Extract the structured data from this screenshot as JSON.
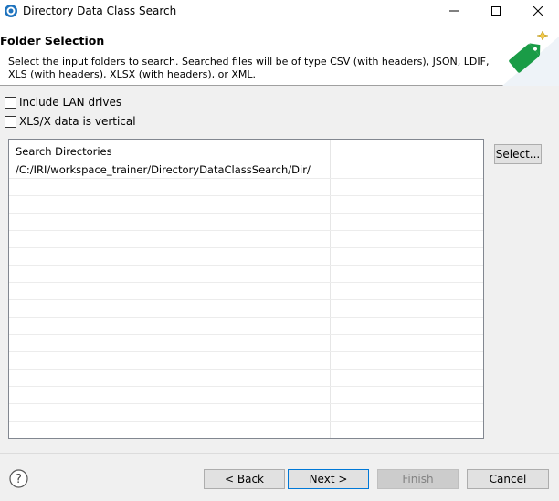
{
  "window": {
    "title": "Directory Data Class Search",
    "controls": {
      "minimize": "—",
      "maximize": "☐",
      "close": "✕"
    }
  },
  "header": {
    "title": "Folder Selection",
    "description": "Select the input folders to search. Searched files will be of type CSV (with headers), JSON, LDIF, XLS (with headers), XLSX (with headers), or XML."
  },
  "options": {
    "include_lan": {
      "label": "Include LAN drives",
      "checked": false
    },
    "xls_vertical": {
      "label": "XLS/X data is vertical",
      "checked": false
    }
  },
  "table": {
    "columns": [
      "Search Directories"
    ],
    "rows": [
      "/C:/IRI/workspace_trainer/DirectoryDataClassSearch/Dir/"
    ]
  },
  "buttons": {
    "select": "Select...",
    "back": "< Back",
    "next": "Next >",
    "finish": "Finish",
    "cancel": "Cancel"
  },
  "colors": {
    "accent": "#0078d7",
    "tag_green": "#1a9c47",
    "app_icon": "#1e73be"
  }
}
